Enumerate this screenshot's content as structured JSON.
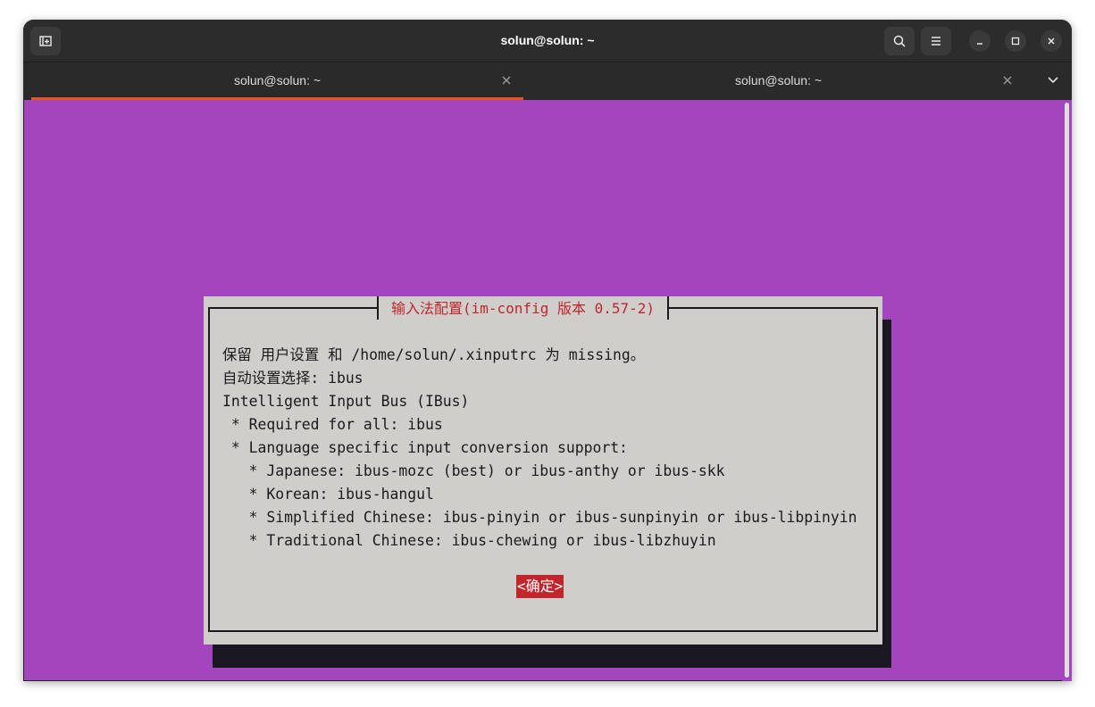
{
  "window": {
    "title": "solun@solun: ~"
  },
  "titlebar_buttons": {
    "new_tab_icon": "new-tab-icon",
    "search_icon": "search-icon",
    "menu_icon": "hamburger-menu-icon",
    "minimize_icon": "minimize-icon",
    "maximize_icon": "maximize-icon",
    "close_icon": "close-icon"
  },
  "tabs": [
    {
      "label": "solun@solun: ~",
      "active": true
    },
    {
      "label": "solun@solun: ~",
      "active": false
    }
  ],
  "dialog": {
    "title": "输入法配置(im-config 版本 0.57-2)",
    "lines": [
      "保留 用户设置 和 /home/solun/.xinputrc 为 missing。",
      "自动设置选择: ibus",
      "Intelligent Input Bus (IBus)",
      " * Required for all: ibus",
      " * Language specific input conversion support:",
      "   * Japanese: ibus-mozc (best) or ibus-anthy or ibus-skk",
      "   * Korean: ibus-hangul",
      "   * Simplified Chinese: ibus-pinyin or ibus-sunpinyin or ibus-libpinyin",
      "   * Traditional Chinese: ibus-chewing or ibus-libzhuyin"
    ],
    "ok_button": "<确定>"
  },
  "colors": {
    "terminal_bg": "#a346be",
    "dialog_bg": "#d0ceca",
    "accent_red": "#c0262c",
    "tab_underline": "#e95420"
  }
}
